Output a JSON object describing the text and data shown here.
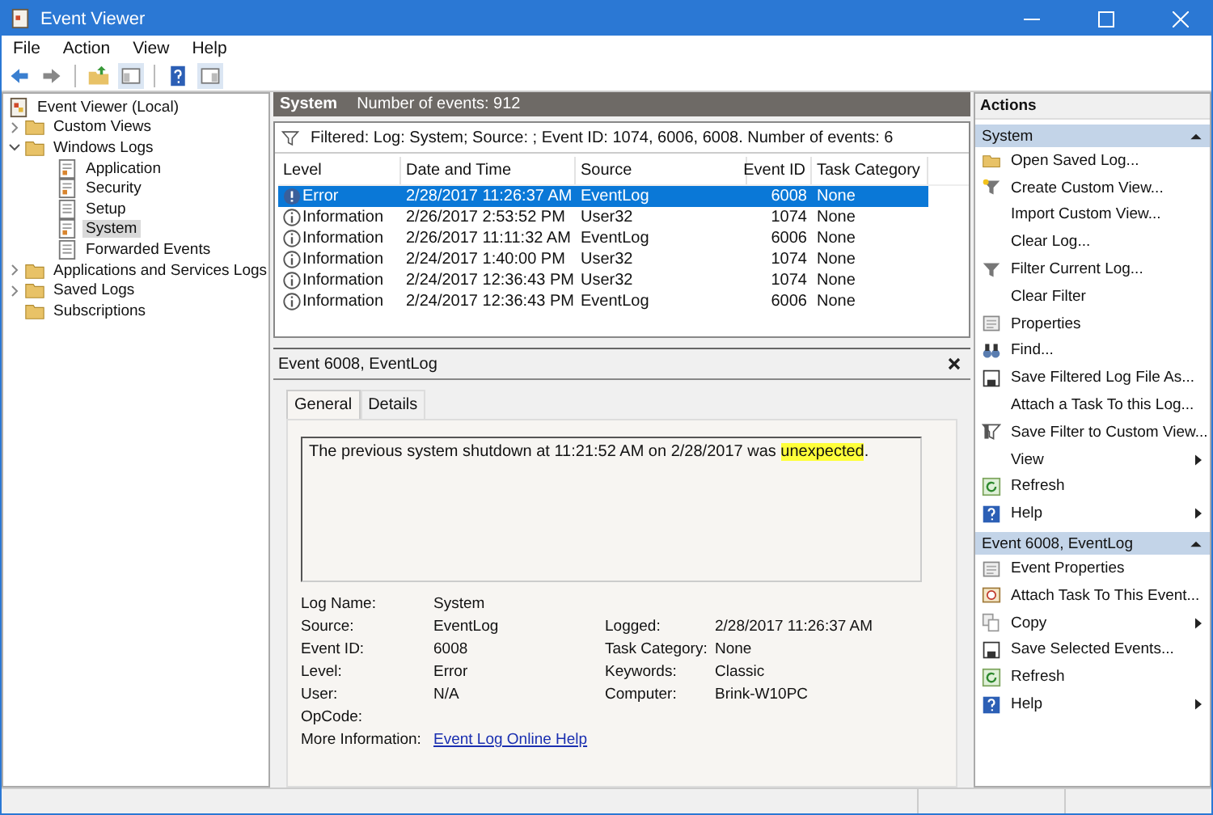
{
  "window": {
    "title": "Event Viewer"
  },
  "menu": [
    {
      "label": "File"
    },
    {
      "label": "Action"
    },
    {
      "label": "View"
    },
    {
      "label": "Help"
    }
  ],
  "tree": [
    {
      "label": "Event Viewer (Local)",
      "kind": "root",
      "selected": false,
      "children": [
        {
          "label": "Custom Views",
          "kind": "folder",
          "expanded": false,
          "selected": false
        },
        {
          "label": "Windows Logs",
          "kind": "folder",
          "expanded": true,
          "selected": false,
          "children": [
            {
              "label": "Application",
              "kind": "log",
              "selected": false
            },
            {
              "label": "Security",
              "kind": "log",
              "selected": false
            },
            {
              "label": "Setup",
              "kind": "plain-log",
              "selected": false
            },
            {
              "label": "System",
              "kind": "log",
              "selected": true
            },
            {
              "label": "Forwarded Events",
              "kind": "plain-log",
              "selected": false
            }
          ]
        },
        {
          "label": "Applications and Services Logs",
          "kind": "folder",
          "expanded": false,
          "selected": false
        },
        {
          "label": "Saved Logs",
          "kind": "folder",
          "expanded": false,
          "selected": false
        },
        {
          "label": "Subscriptions",
          "kind": "folder",
          "selected": false
        }
      ]
    }
  ],
  "log_header": {
    "title": "System",
    "count": "Number of events: 912"
  },
  "filter": "Filtered: Log: System; Source: ; Event ID: 1074, 6006, 6008. Number of events: 6",
  "table": {
    "columns": [
      "Level",
      "Date and Time",
      "Source",
      "Event ID",
      "Task Category"
    ],
    "rows": [
      {
        "kind": "error",
        "selected": true,
        "cells": [
          "Error",
          "2/28/2017 11:26:37 AM",
          "EventLog",
          "6008",
          "None"
        ]
      },
      {
        "kind": "info",
        "selected": false,
        "cells": [
          "Information",
          "2/26/2017 2:53:52 PM",
          "User32",
          "1074",
          "None"
        ]
      },
      {
        "kind": "info",
        "selected": false,
        "cells": [
          "Information",
          "2/26/2017 11:11:32 AM",
          "EventLog",
          "6006",
          "None"
        ]
      },
      {
        "kind": "info",
        "selected": false,
        "cells": [
          "Information",
          "2/24/2017 1:40:00 PM",
          "User32",
          "1074",
          "None"
        ]
      },
      {
        "kind": "info",
        "selected": false,
        "cells": [
          "Information",
          "2/24/2017 12:36:43 PM",
          "User32",
          "1074",
          "None"
        ]
      },
      {
        "kind": "info",
        "selected": false,
        "cells": [
          "Information",
          "2/24/2017 12:36:43 PM",
          "EventLog",
          "6006",
          "None"
        ]
      }
    ]
  },
  "detail": {
    "title": "Event 6008, EventLog",
    "tabs": [
      {
        "label": "General",
        "selected": true
      },
      {
        "label": "Details",
        "selected": false
      }
    ],
    "message": {
      "before": "The previous system shutdown at 11:21:52 AM on 2/28/2017 was ",
      "highlighted": "unexpected",
      "after": "."
    },
    "properties": [
      {
        "label": "Log Name:",
        "value": "System"
      },
      {
        "label": "Source:",
        "value": "EventLog",
        "label2": "Logged:",
        "value2": "2/28/2017 11:26:37 AM"
      },
      {
        "label": "Event ID:",
        "value": "6008",
        "label2": "Task Category:",
        "value2": "None"
      },
      {
        "label": "Level:",
        "value": "Error",
        "label2": "Keywords:",
        "value2": "Classic"
      },
      {
        "label": "User:",
        "value": "N/A",
        "label2": "Computer:",
        "value2": "Brink-W10PC"
      },
      {
        "label": "OpCode:"
      },
      {
        "label": "More Information:",
        "link": "Event Log Online Help"
      }
    ]
  },
  "actions": {
    "title": "Actions",
    "sections": [
      {
        "title": "System",
        "expanded": true,
        "items": [
          {
            "label": "Open Saved Log...",
            "kind": "folder"
          },
          {
            "label": "Create Custom View...",
            "kind": "filter-star"
          },
          {
            "label": "Import Custom View..."
          },
          {
            "label": "Clear Log..."
          },
          {
            "label": "Filter Current Log...",
            "kind": "filter"
          },
          {
            "label": "Clear Filter"
          },
          {
            "label": "Properties",
            "kind": "properties"
          },
          {
            "label": "Find...",
            "kind": "binoculars"
          },
          {
            "label": "Save Filtered Log File As...",
            "kind": "disk"
          },
          {
            "label": "Attach a Task To this Log..."
          },
          {
            "label": "Save Filter to Custom View...",
            "kind": "filter-save"
          },
          {
            "label": "View",
            "submenu": true
          },
          {
            "label": "Refresh",
            "kind": "refresh"
          },
          {
            "label": "Help",
            "kind": "help",
            "submenu": true
          }
        ]
      },
      {
        "title": "Event 6008, EventLog",
        "expanded": true,
        "items": [
          {
            "label": "Event Properties",
            "kind": "properties"
          },
          {
            "label": "Attach Task To This Event...",
            "kind": "clock"
          },
          {
            "label": "Copy",
            "kind": "copy",
            "submenu": true
          },
          {
            "label": "Save Selected Events...",
            "kind": "disk"
          },
          {
            "label": "Refresh",
            "kind": "refresh"
          },
          {
            "label": "Help",
            "kind": "help",
            "submenu": true
          }
        ]
      }
    ]
  }
}
